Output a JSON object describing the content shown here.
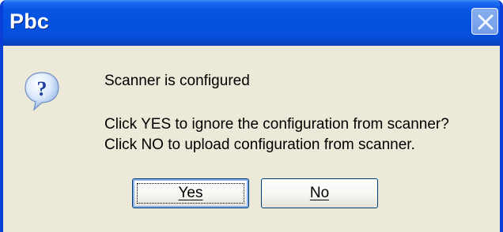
{
  "window": {
    "title": "Pbc",
    "close_icon": "close-icon"
  },
  "dialog": {
    "icon": "question-icon",
    "heading": "Scanner  is configured",
    "line1": "Click YES to ignore the configuration from scanner?",
    "line2": "Click NO to upload configuration from scanner."
  },
  "buttons": {
    "yes_label": "Yes",
    "no_label": "No"
  },
  "colors": {
    "titlebar": "#0452e0",
    "window_face": "#ece9d8",
    "button_border": "#003c74"
  }
}
